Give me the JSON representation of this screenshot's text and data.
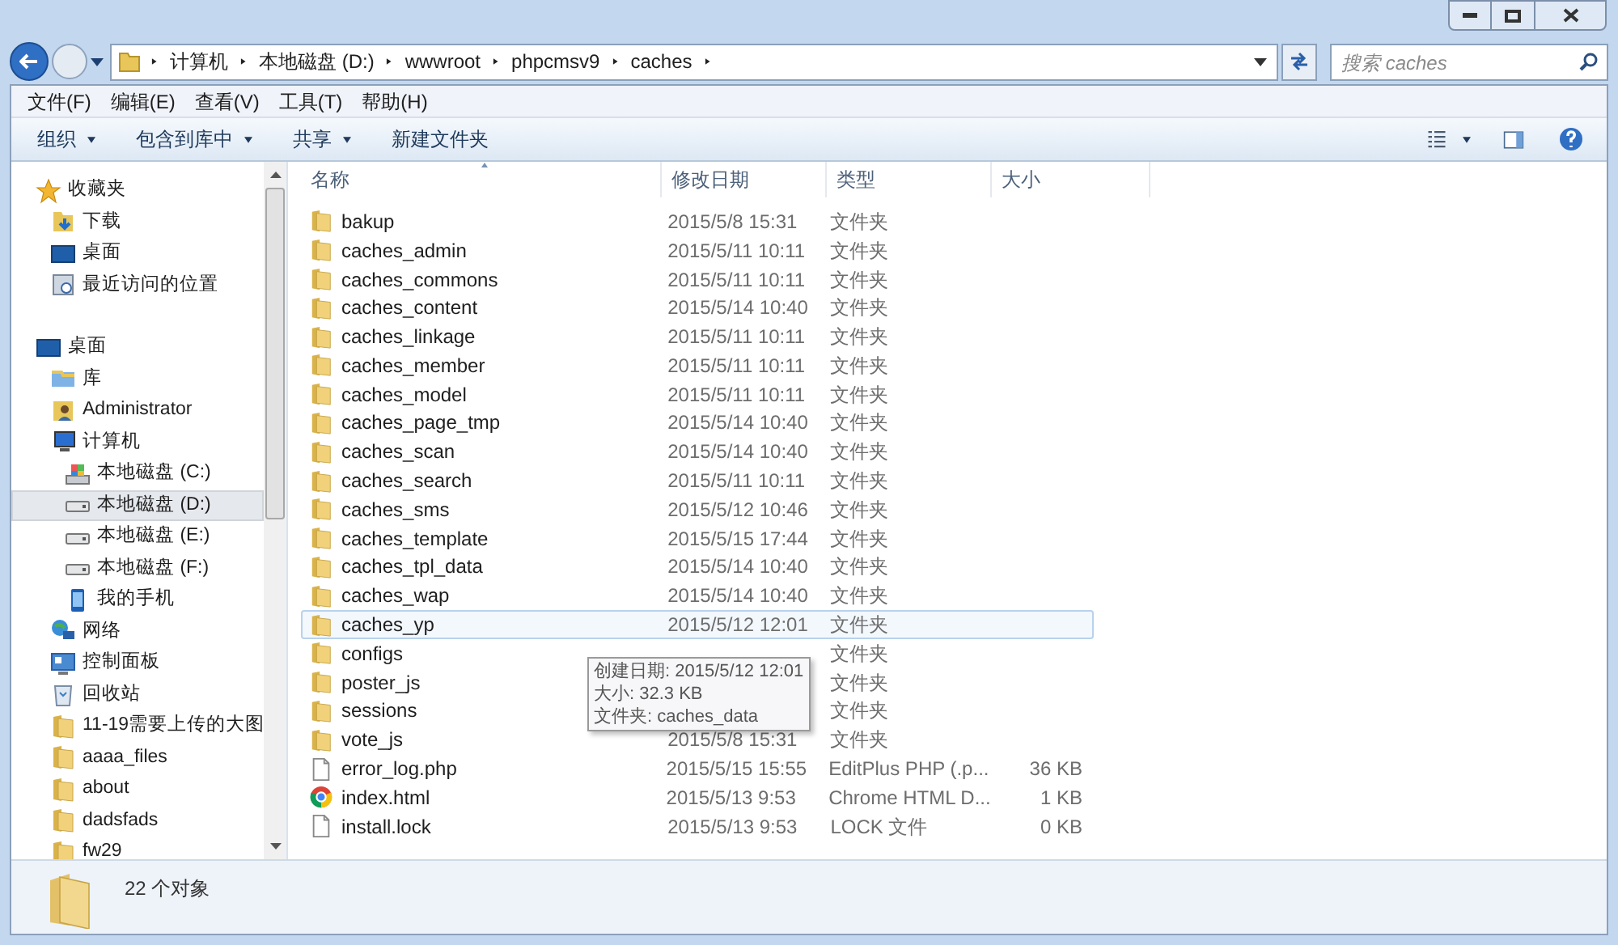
{
  "address_bar": {
    "path": [
      "计算机",
      "本地磁盘 (D:)",
      "wwwroot",
      "phpcmsv9",
      "caches"
    ]
  },
  "search": {
    "placeholder": "搜索 caches"
  },
  "menu": [
    "文件(F)",
    "编辑(E)",
    "查看(V)",
    "工具(T)",
    "帮助(H)"
  ],
  "toolbar": [
    {
      "label": "组织",
      "dropdown": true
    },
    {
      "label": "包含到库中",
      "dropdown": true
    },
    {
      "label": "共享",
      "dropdown": true
    },
    {
      "label": "新建文件夹",
      "dropdown": false
    }
  ],
  "sidebar": {
    "items": [
      {
        "label": "收藏夹",
        "kind": "star",
        "selected": false,
        "children": [
          {
            "label": "下载",
            "kind": "download",
            "selected": false
          },
          {
            "label": "桌面",
            "kind": "desktop",
            "selected": false
          },
          {
            "label": "最近访问的位置",
            "kind": "recent",
            "selected": false
          }
        ]
      },
      {
        "label": "桌面",
        "kind": "desktop",
        "selected": false,
        "children": [
          {
            "label": "库",
            "kind": "library",
            "selected": false
          },
          {
            "label": "Administrator",
            "kind": "user",
            "selected": false
          },
          {
            "label": "计算机",
            "kind": "computer",
            "selected": false,
            "children": [
              {
                "label": "本地磁盘 (C:)",
                "kind": "sysdrive",
                "selected": false
              },
              {
                "label": "本地磁盘 (D:)",
                "kind": "drive",
                "selected": true
              },
              {
                "label": "本地磁盘 (E:)",
                "kind": "drive",
                "selected": false
              },
              {
                "label": "本地磁盘 (F:)",
                "kind": "drive",
                "selected": false
              },
              {
                "label": "我的手机",
                "kind": "phone",
                "selected": false
              }
            ]
          },
          {
            "label": "网络",
            "kind": "network",
            "selected": false
          },
          {
            "label": "控制面板",
            "kind": "control",
            "selected": false
          },
          {
            "label": "回收站",
            "kind": "recycle",
            "selected": false
          },
          {
            "label": "11-19需要上传的大图",
            "kind": "folder",
            "selected": false
          },
          {
            "label": "aaaa_files",
            "kind": "folder",
            "selected": false
          },
          {
            "label": "about",
            "kind": "folder",
            "selected": false
          },
          {
            "label": "dadsfads",
            "kind": "folder",
            "selected": false
          },
          {
            "label": "fw29",
            "kind": "folder",
            "selected": false
          }
        ]
      }
    ]
  },
  "table": {
    "columns": [
      "名称",
      "修改日期",
      "类型",
      "大小"
    ],
    "rows": [
      {
        "name": "bakup",
        "date": "2015/5/8 15:31",
        "type": "文件夹",
        "kind": "folder",
        "hovered": false
      },
      {
        "name": "caches_admin",
        "date": "2015/5/11 10:11",
        "type": "文件夹",
        "kind": "folder",
        "hovered": false
      },
      {
        "name": "caches_commons",
        "date": "2015/5/11 10:11",
        "type": "文件夹",
        "kind": "folder",
        "hovered": false
      },
      {
        "name": "caches_content",
        "date": "2015/5/14 10:40",
        "type": "文件夹",
        "kind": "folder",
        "hovered": false
      },
      {
        "name": "caches_linkage",
        "date": "2015/5/11 10:11",
        "type": "文件夹",
        "kind": "folder",
        "hovered": false
      },
      {
        "name": "caches_member",
        "date": "2015/5/11 10:11",
        "type": "文件夹",
        "kind": "folder",
        "hovered": false
      },
      {
        "name": "caches_model",
        "date": "2015/5/11 10:11",
        "type": "文件夹",
        "kind": "folder",
        "hovered": false
      },
      {
        "name": "caches_page_tmp",
        "date": "2015/5/14 10:40",
        "type": "文件夹",
        "kind": "folder",
        "hovered": false
      },
      {
        "name": "caches_scan",
        "date": "2015/5/14 10:40",
        "type": "文件夹",
        "kind": "folder",
        "hovered": false
      },
      {
        "name": "caches_search",
        "date": "2015/5/11 10:11",
        "type": "文件夹",
        "kind": "folder",
        "hovered": false
      },
      {
        "name": "caches_sms",
        "date": "2015/5/12 10:46",
        "type": "文件夹",
        "kind": "folder",
        "hovered": false
      },
      {
        "name": "caches_template",
        "date": "2015/5/15 17:44",
        "type": "文件夹",
        "kind": "folder",
        "hovered": false
      },
      {
        "name": "caches_tpl_data",
        "date": "2015/5/14 10:40",
        "type": "文件夹",
        "kind": "folder",
        "hovered": false
      },
      {
        "name": "caches_wap",
        "date": "2015/5/14 10:40",
        "type": "文件夹",
        "kind": "folder",
        "hovered": false
      },
      {
        "name": "caches_yp",
        "date": "2015/5/12 12:01",
        "type": "文件夹",
        "kind": "folder",
        "hovered": true
      },
      {
        "name": "configs",
        "type": "文件夹",
        "kind": "folder",
        "hovered": false
      },
      {
        "name": "poster_js",
        "type": "文件夹",
        "kind": "folder",
        "hovered": false
      },
      {
        "name": "sessions",
        "type": "文件夹",
        "kind": "folder",
        "hovered": false
      },
      {
        "name": "vote_js",
        "date": "2015/5/8 15:31",
        "type": "文件夹",
        "kind": "folder",
        "hovered": false
      },
      {
        "name": "error_log.php",
        "date": "2015/5/15 15:55",
        "type": "EditPlus PHP (.p...",
        "size": "36 KB",
        "kind": "file",
        "hovered": false
      },
      {
        "name": "index.html",
        "date": "2015/5/13 9:53",
        "type": "Chrome HTML D...",
        "size": "1 KB",
        "kind": "chrome",
        "hovered": false
      },
      {
        "name": "install.lock",
        "date": "2015/5/13 9:53",
        "type": "LOCK 文件",
        "size": "0 KB",
        "kind": "file",
        "hovered": false
      }
    ]
  },
  "tooltip": [
    "创建日期: 2015/5/12 12:01",
    "大小: 32.3 KB",
    "文件夹: caches_data"
  ],
  "status_bar": {
    "count": "22 个对象"
  }
}
